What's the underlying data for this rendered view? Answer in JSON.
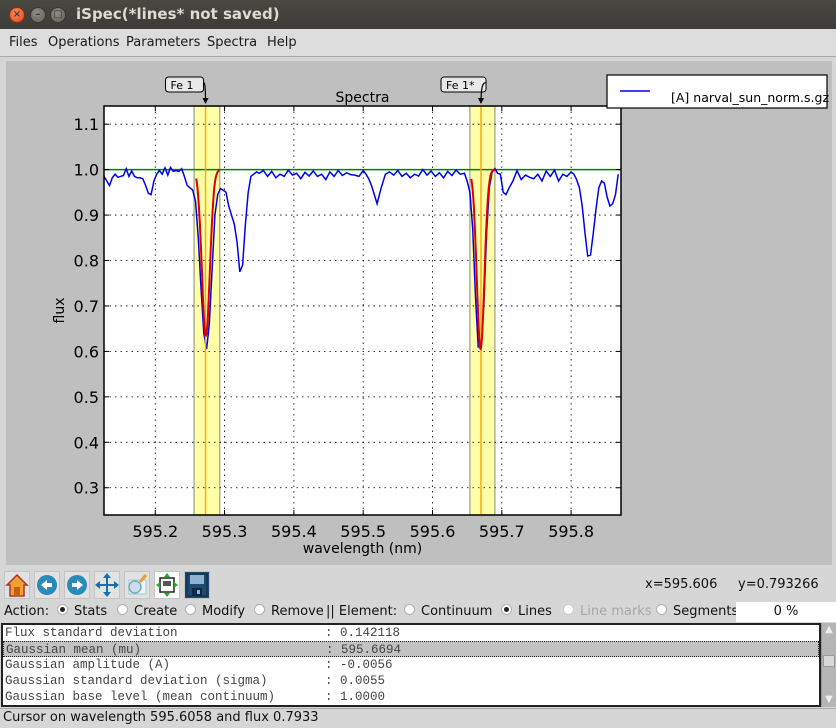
{
  "window": {
    "title": "iSpec(*lines* not saved)",
    "controls": [
      "close",
      "minimize",
      "maximize"
    ]
  },
  "menubar": {
    "items": [
      {
        "label": "Files"
      },
      {
        "label": "Operations"
      },
      {
        "label": "Parameters"
      },
      {
        "label": "Spectra"
      },
      {
        "label": "Help"
      }
    ]
  },
  "chart_data": {
    "type": "line",
    "title": "Spectra",
    "xlabel": "wavelength (nm)",
    "ylabel": "flux",
    "xlim": [
      595.126,
      595.872
    ],
    "ylim": [
      0.24,
      1.14
    ],
    "x_ticks": [
      595.2,
      595.3,
      595.4,
      595.5,
      595.6,
      595.7,
      595.8
    ],
    "x_tick_labels": [
      "595.2",
      "595.3",
      "595.4",
      "595.5",
      "595.6",
      "595.7",
      "595.8"
    ],
    "y_ticks": [
      0.3,
      0.4,
      0.5,
      0.6,
      0.7,
      0.8,
      0.9,
      1.0,
      1.1
    ],
    "y_tick_labels": [
      "0.3",
      "0.4",
      "0.5",
      "0.6",
      "0.7",
      "0.8",
      "0.9",
      "1.0",
      "1.1"
    ],
    "grid": true,
    "legend": {
      "position": "top-right-outside",
      "entries": [
        {
          "label": "[A] narval_sun_norm.s.gz",
          "color": "#0000ee"
        }
      ]
    },
    "continuum_level": 1.0,
    "colors": {
      "spectrum": "#0000ee",
      "continuum": "#008000",
      "fit": "#dd0000",
      "line_marker": "#ffaa00",
      "region_fill": "#ffff99",
      "region_edge": "#b0b090"
    },
    "series": [
      {
        "name": "[A] narval_sun_norm.s.gz",
        "x": [
          595.126,
          595.13,
          595.134,
          595.138,
          595.142,
          595.146,
          595.15,
          595.154,
          595.158,
          595.162,
          595.166,
          595.17,
          595.174,
          595.178,
          595.182,
          595.186,
          595.19,
          595.194,
          595.198,
          595.202,
          595.206,
          595.21,
          595.214,
          595.218,
          595.222,
          595.226,
          595.23,
          595.234,
          595.238,
          595.242,
          595.246,
          595.25,
          595.254,
          595.258,
          595.262,
          595.266,
          595.27,
          595.274,
          595.278,
          595.282,
          595.286,
          595.29,
          595.294,
          595.298,
          595.302,
          595.306,
          595.31,
          595.314,
          595.318,
          595.322,
          595.326,
          595.33,
          595.334,
          595.338,
          595.342,
          595.346,
          595.35,
          595.356,
          595.362,
          595.368,
          595.374,
          595.38,
          595.386,
          595.392,
          595.398,
          595.404,
          595.41,
          595.416,
          595.422,
          595.428,
          595.434,
          595.44,
          595.446,
          595.452,
          595.458,
          595.464,
          595.47,
          595.476,
          595.482,
          595.488,
          595.494,
          595.5,
          595.504,
          595.508,
          595.512,
          595.516,
          595.52,
          595.526,
          595.532,
          595.538,
          595.544,
          595.55,
          595.556,
          595.562,
          595.568,
          595.574,
          595.58,
          595.586,
          595.592,
          595.598,
          595.604,
          595.61,
          595.616,
          595.622,
          595.628,
          595.634,
          595.64,
          595.646,
          595.65,
          595.654,
          595.658,
          595.662,
          595.666,
          595.67,
          595.674,
          595.678,
          595.682,
          595.686,
          595.69,
          595.694,
          595.698,
          595.702,
          595.706,
          595.71,
          595.716,
          595.722,
          595.728,
          595.734,
          595.74,
          595.746,
          595.752,
          595.758,
          595.764,
          595.77,
          595.776,
          595.782,
          595.788,
          595.794,
          595.8,
          595.804,
          595.808,
          595.812,
          595.816,
          595.82,
          595.824,
          595.828,
          595.832,
          595.836,
          595.84,
          595.844,
          595.848,
          595.852,
          595.856,
          595.86,
          595.864,
          595.868,
          595.872
        ],
        "y": [
          0.985,
          0.975,
          0.965,
          0.982,
          0.99,
          0.983,
          0.985,
          0.987,
          1.002,
          0.985,
          0.997,
          0.985,
          0.982,
          0.982,
          0.98,
          0.965,
          0.948,
          0.945,
          0.975,
          0.99,
          0.998,
          0.99,
          1.004,
          0.988,
          1.005,
          0.996,
          0.998,
          0.996,
          1.002,
          0.985,
          0.965,
          0.96,
          0.955,
          0.93,
          0.85,
          0.74,
          0.64,
          0.605,
          0.66,
          0.78,
          0.9,
          0.945,
          0.958,
          0.955,
          0.95,
          0.92,
          0.9,
          0.88,
          0.84,
          0.775,
          0.79,
          0.88,
          0.95,
          0.985,
          0.99,
          0.995,
          0.992,
          0.998,
          0.985,
          0.996,
          0.982,
          0.99,
          0.985,
          0.999,
          0.988,
          0.992,
          0.98,
          0.994,
          0.986,
          0.997,
          0.985,
          0.99,
          0.978,
          0.995,
          0.985,
          0.998,
          0.987,
          0.993,
          0.989,
          0.988,
          0.985,
          0.998,
          0.99,
          0.98,
          0.965,
          0.945,
          0.925,
          0.96,
          0.99,
          0.995,
          0.988,
          0.998,
          0.985,
          0.992,
          0.982,
          0.99,
          0.986,
          1.0,
          0.988,
          0.997,
          0.985,
          0.993,
          0.982,
          0.996,
          0.987,
          0.999,
          0.99,
          0.992,
          0.975,
          0.95,
          0.87,
          0.72,
          0.61,
          0.61,
          0.7,
          0.86,
          0.96,
          0.995,
          1.002,
          0.992,
          0.99,
          0.95,
          0.945,
          0.958,
          0.975,
          0.998,
          0.978,
          0.988,
          0.983,
          0.98,
          0.99,
          0.975,
          0.997,
          0.985,
          0.999,
          0.975,
          0.99,
          0.985,
          0.995,
          0.99,
          0.978,
          0.96,
          0.92,
          0.86,
          0.81,
          0.812,
          0.86,
          0.915,
          0.96,
          0.975,
          0.97,
          0.94,
          0.92,
          0.925,
          0.945,
          0.99
        ]
      }
    ],
    "regions": [
      {
        "label": "Fe 1",
        "start": 595.256,
        "end": 595.293,
        "peak": 595.2725,
        "fit": {
          "mean": 595.273,
          "amplitude_depth": 0.365,
          "sigma": 0.0058,
          "base": 1.0,
          "x_range": [
            595.259,
            595.293
          ]
        }
      },
      {
        "label": "Fe 1*",
        "start": 595.654,
        "end": 595.69,
        "peak": 595.67,
        "fit": {
          "mean": 595.6694,
          "amplitude_depth": 0.395,
          "sigma": 0.0055,
          "base": 1.0,
          "x_range": [
            595.656,
            595.69
          ]
        }
      }
    ]
  },
  "toolbar": {
    "buttons": [
      {
        "name": "home-button",
        "icon": "home-icon",
        "tooltip": "Reset original view"
      },
      {
        "name": "back-button",
        "icon": "arrow-left-icon",
        "tooltip": "Back"
      },
      {
        "name": "forward-button",
        "icon": "arrow-right-icon",
        "tooltip": "Forward"
      },
      {
        "name": "pan-button",
        "icon": "move-icon",
        "tooltip": "Pan"
      },
      {
        "name": "zoom-button",
        "icon": "zoom-rect-icon",
        "tooltip": "Zoom"
      },
      {
        "name": "subplots-button",
        "icon": "subplots-icon",
        "tooltip": "Configure subplots"
      },
      {
        "name": "save-button",
        "icon": "floppy-icon",
        "tooltip": "Save"
      }
    ],
    "x_readout": "x=595.606",
    "y_readout": "y=0.793266"
  },
  "actionbar": {
    "action_label": "Action:",
    "actions": [
      {
        "label": "Stats",
        "selected": true
      },
      {
        "label": "Create",
        "selected": false
      },
      {
        "label": "Modify",
        "selected": false
      },
      {
        "label": "Remove",
        "selected": false
      }
    ],
    "element_label": "|| Element:",
    "elements": [
      {
        "label": "Continuum",
        "selected": false,
        "disabled": false
      },
      {
        "label": "Lines",
        "selected": true,
        "disabled": false
      },
      {
        "label": "Line marks",
        "selected": false,
        "disabled": true
      },
      {
        "label": "Segments",
        "selected": false,
        "disabled": false
      }
    ],
    "progress": "0 %"
  },
  "stats": {
    "rows": [
      {
        "key": "Flux standard deviation",
        "value": ": 0.142118",
        "selected": false
      },
      {
        "key": "Gaussian mean (mu)",
        "value": ": 595.6694",
        "selected": true
      },
      {
        "key": "Gaussian amplitude (A)",
        "value": ": -0.0056",
        "selected": false
      },
      {
        "key": "Gaussian standard deviation (sigma)",
        "value": ": 0.0055",
        "selected": false
      },
      {
        "key": "Gaussian base level (mean continuum)",
        "value": ": 1.0000",
        "selected": false
      }
    ]
  },
  "statusbar": {
    "text": "Cursor on wavelength 595.6058 and flux 0.7933"
  }
}
